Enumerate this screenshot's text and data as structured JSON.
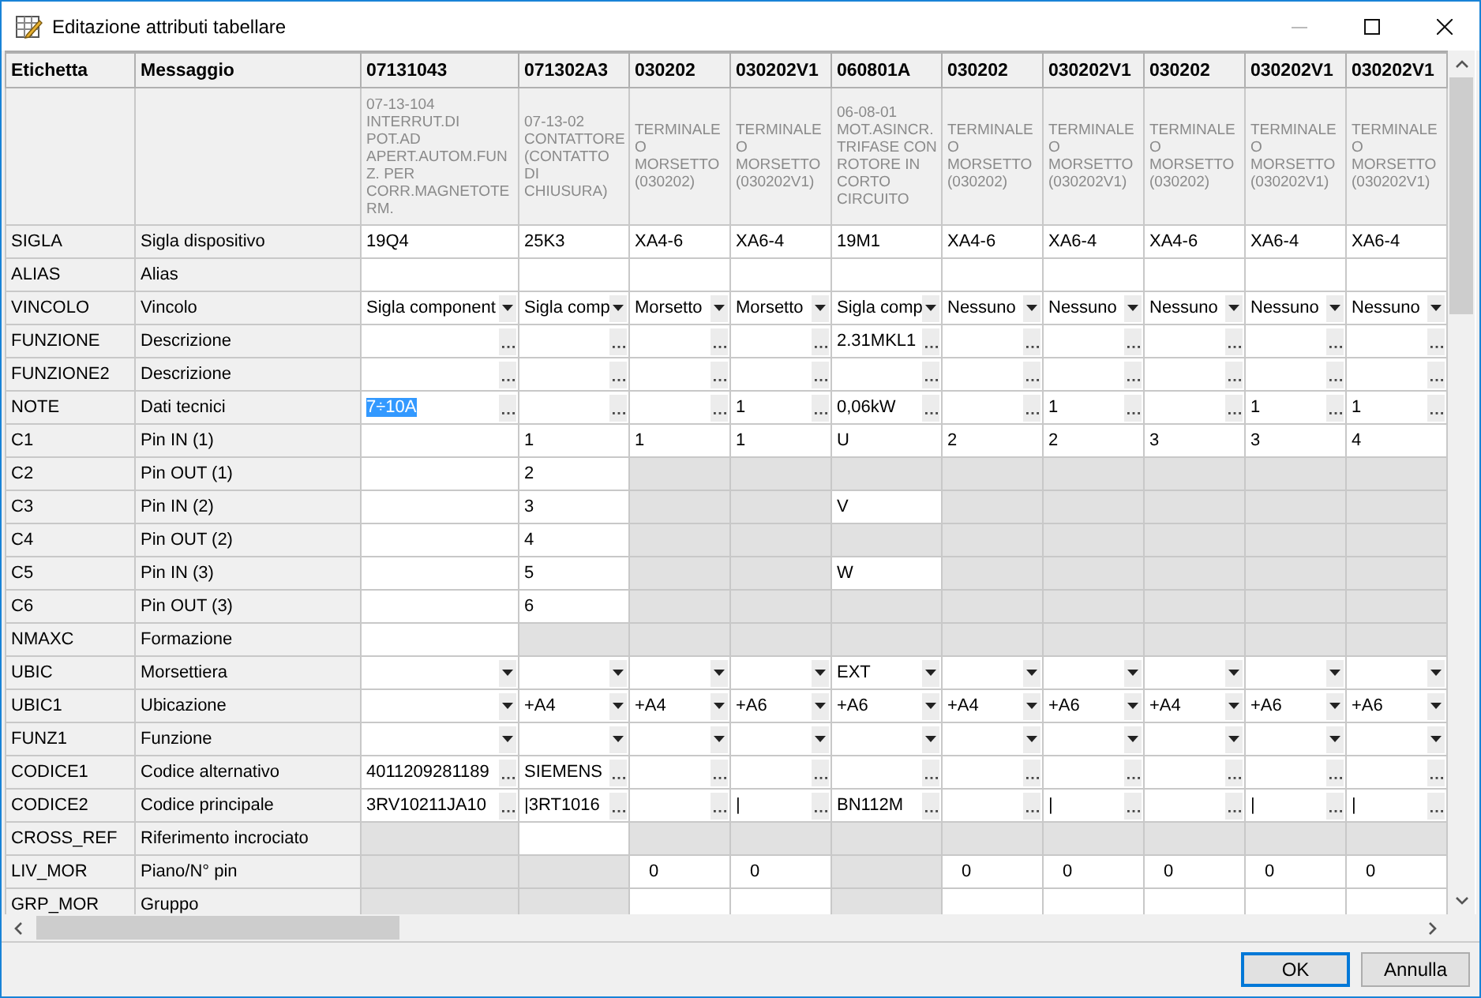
{
  "window": {
    "title": "Editazione attributi tabellare"
  },
  "table": {
    "columns": [
      {
        "label": "Etichetta"
      },
      {
        "label": "Messaggio"
      },
      {
        "label": "07131043"
      },
      {
        "label": "071302A3"
      },
      {
        "label": "030202"
      },
      {
        "label": "030202V1"
      },
      {
        "label": "060801A"
      },
      {
        "label": "030202"
      },
      {
        "label": "030202V1"
      },
      {
        "label": "030202"
      },
      {
        "label": "030202V1"
      },
      {
        "label": "030202V1"
      }
    ],
    "rows": [
      {
        "cells": [
          {
            "kind": "label"
          },
          {
            "kind": "label"
          },
          {
            "kind": "description",
            "value": "07-13-104 INTERRUT.DI POT.AD APERT.AUTOM.FUNZ. PER CORR.MAGNETOTERM."
          },
          {
            "kind": "description",
            "value": "07-13-02 CONTATTORE (CONTATTO DI CHIUSURA)"
          },
          {
            "kind": "description",
            "value": "TERMINALE O MORSETTO (030202)"
          },
          {
            "kind": "description",
            "value": "TERMINALE O MORSETTO (030202V1)"
          },
          {
            "kind": "description",
            "value": "06-08-01 MOT.ASINCR. TRIFASE CON ROTORE IN CORTO CIRCUITO"
          },
          {
            "kind": "description",
            "value": "TERMINALE O MORSETTO (030202)"
          },
          {
            "kind": "description",
            "value": "TERMINALE O MORSETTO (030202V1)"
          },
          {
            "kind": "description",
            "value": "TERMINALE O MORSETTO (030202)"
          },
          {
            "kind": "description",
            "value": "TERMINALE O MORSETTO (030202V1)"
          },
          {
            "kind": "description",
            "value": "TERMINALE O MORSETTO (030202V1)"
          }
        ]
      },
      {
        "cells": [
          {
            "kind": "label",
            "value": "SIGLA"
          },
          {
            "kind": "label",
            "value": "Sigla dispositivo"
          },
          {
            "kind": "text",
            "value": "19Q4"
          },
          {
            "kind": "text",
            "value": "25K3"
          },
          {
            "kind": "text",
            "value": "XA4-6"
          },
          {
            "kind": "text",
            "value": "XA6-4"
          },
          {
            "kind": "text",
            "value": "19M1"
          },
          {
            "kind": "text",
            "value": "XA4-6"
          },
          {
            "kind": "text",
            "value": "XA6-4"
          },
          {
            "kind": "text",
            "value": "XA4-6"
          },
          {
            "kind": "text",
            "value": "XA6-4"
          },
          {
            "kind": "text",
            "value": "XA6-4"
          }
        ]
      },
      {
        "cells": [
          {
            "kind": "label",
            "value": "ALIAS"
          },
          {
            "kind": "label",
            "value": "Alias"
          },
          {
            "kind": "text"
          },
          {
            "kind": "text"
          },
          {
            "kind": "text"
          },
          {
            "kind": "text"
          },
          {
            "kind": "text"
          },
          {
            "kind": "text"
          },
          {
            "kind": "text"
          },
          {
            "kind": "text"
          },
          {
            "kind": "text"
          },
          {
            "kind": "text"
          }
        ]
      },
      {
        "cells": [
          {
            "kind": "label",
            "value": "VINCOLO"
          },
          {
            "kind": "label",
            "value": "Vincolo"
          },
          {
            "kind": "combo",
            "value": "Sigla component"
          },
          {
            "kind": "combo",
            "value": "Sigla comp"
          },
          {
            "kind": "combo",
            "value": "Morsetto"
          },
          {
            "kind": "combo",
            "value": "Morsetto"
          },
          {
            "kind": "combo",
            "value": "Sigla comp"
          },
          {
            "kind": "combo",
            "value": "Nessuno"
          },
          {
            "kind": "combo",
            "value": "Nessuno"
          },
          {
            "kind": "combo",
            "value": "Nessuno"
          },
          {
            "kind": "combo",
            "value": "Nessuno"
          },
          {
            "kind": "combo",
            "value": "Nessuno"
          }
        ]
      },
      {
        "cells": [
          {
            "kind": "label",
            "value": "FUNZIONE"
          },
          {
            "kind": "label",
            "value": "Descrizione"
          },
          {
            "kind": "browse"
          },
          {
            "kind": "browse"
          },
          {
            "kind": "browse"
          },
          {
            "kind": "browse"
          },
          {
            "kind": "browse",
            "value": "2.31MKL1"
          },
          {
            "kind": "browse"
          },
          {
            "kind": "browse"
          },
          {
            "kind": "browse"
          },
          {
            "kind": "browse"
          },
          {
            "kind": "browse"
          }
        ]
      },
      {
        "cells": [
          {
            "kind": "label",
            "value": "FUNZIONE2"
          },
          {
            "kind": "label",
            "value": "Descrizione"
          },
          {
            "kind": "browse"
          },
          {
            "kind": "browse"
          },
          {
            "kind": "browse"
          },
          {
            "kind": "browse"
          },
          {
            "kind": "browse"
          },
          {
            "kind": "browse"
          },
          {
            "kind": "browse"
          },
          {
            "kind": "browse"
          },
          {
            "kind": "browse"
          },
          {
            "kind": "browse"
          }
        ]
      },
      {
        "cells": [
          {
            "kind": "label",
            "value": "NOTE"
          },
          {
            "kind": "label",
            "value": "Dati tecnici"
          },
          {
            "kind": "editing",
            "value": "7÷10A"
          },
          {
            "kind": "browse"
          },
          {
            "kind": "browse"
          },
          {
            "kind": "browse",
            "value": "1"
          },
          {
            "kind": "browse",
            "value": "0,06kW"
          },
          {
            "kind": "browse"
          },
          {
            "kind": "browse",
            "value": "1"
          },
          {
            "kind": "browse"
          },
          {
            "kind": "browse",
            "value": "1"
          },
          {
            "kind": "browse",
            "value": "1"
          }
        ]
      },
      {
        "cells": [
          {
            "kind": "label",
            "value": "C1"
          },
          {
            "kind": "label",
            "value": "Pin IN (1)"
          },
          {
            "kind": "text"
          },
          {
            "kind": "text",
            "value": "1"
          },
          {
            "kind": "text",
            "value": "1"
          },
          {
            "kind": "text",
            "value": "1"
          },
          {
            "kind": "text",
            "value": "U"
          },
          {
            "kind": "text",
            "value": "2"
          },
          {
            "kind": "text",
            "value": "2"
          },
          {
            "kind": "text",
            "value": "3"
          },
          {
            "kind": "text",
            "value": "3"
          },
          {
            "kind": "text",
            "value": "4"
          }
        ]
      },
      {
        "cells": [
          {
            "kind": "label",
            "value": "C2"
          },
          {
            "kind": "label",
            "value": "Pin OUT (1)"
          },
          {
            "kind": "text"
          },
          {
            "kind": "text",
            "value": "2"
          },
          {
            "kind": "off"
          },
          {
            "kind": "off"
          },
          {
            "kind": "off"
          },
          {
            "kind": "off"
          },
          {
            "kind": "off"
          },
          {
            "kind": "off"
          },
          {
            "kind": "off"
          },
          {
            "kind": "off"
          }
        ]
      },
      {
        "cells": [
          {
            "kind": "label",
            "value": "C3"
          },
          {
            "kind": "label",
            "value": "Pin IN (2)"
          },
          {
            "kind": "text"
          },
          {
            "kind": "text",
            "value": "3"
          },
          {
            "kind": "off"
          },
          {
            "kind": "off"
          },
          {
            "kind": "text",
            "value": "V"
          },
          {
            "kind": "off"
          },
          {
            "kind": "off"
          },
          {
            "kind": "off"
          },
          {
            "kind": "off"
          },
          {
            "kind": "off"
          }
        ]
      },
      {
        "cells": [
          {
            "kind": "label",
            "value": "C4"
          },
          {
            "kind": "label",
            "value": "Pin OUT (2)"
          },
          {
            "kind": "text"
          },
          {
            "kind": "text",
            "value": "4"
          },
          {
            "kind": "off"
          },
          {
            "kind": "off"
          },
          {
            "kind": "off"
          },
          {
            "kind": "off"
          },
          {
            "kind": "off"
          },
          {
            "kind": "off"
          },
          {
            "kind": "off"
          },
          {
            "kind": "off"
          }
        ]
      },
      {
        "cells": [
          {
            "kind": "label",
            "value": "C5"
          },
          {
            "kind": "label",
            "value": "Pin IN (3)"
          },
          {
            "kind": "text"
          },
          {
            "kind": "text",
            "value": "5"
          },
          {
            "kind": "off"
          },
          {
            "kind": "off"
          },
          {
            "kind": "text",
            "value": "W"
          },
          {
            "kind": "off"
          },
          {
            "kind": "off"
          },
          {
            "kind": "off"
          },
          {
            "kind": "off"
          },
          {
            "kind": "off"
          }
        ]
      },
      {
        "cells": [
          {
            "kind": "label",
            "value": "C6"
          },
          {
            "kind": "label",
            "value": "Pin OUT (3)"
          },
          {
            "kind": "text"
          },
          {
            "kind": "text",
            "value": "6"
          },
          {
            "kind": "off"
          },
          {
            "kind": "off"
          },
          {
            "kind": "off"
          },
          {
            "kind": "off"
          },
          {
            "kind": "off"
          },
          {
            "kind": "off"
          },
          {
            "kind": "off"
          },
          {
            "kind": "off"
          }
        ]
      },
      {
        "cells": [
          {
            "kind": "label",
            "value": "NMAXC"
          },
          {
            "kind": "label",
            "value": "Formazione"
          },
          {
            "kind": "text"
          },
          {
            "kind": "off"
          },
          {
            "kind": "off"
          },
          {
            "kind": "off"
          },
          {
            "kind": "off"
          },
          {
            "kind": "off"
          },
          {
            "kind": "off"
          },
          {
            "kind": "off"
          },
          {
            "kind": "off"
          },
          {
            "kind": "off"
          }
        ]
      },
      {
        "cells": [
          {
            "kind": "label",
            "value": "UBIC"
          },
          {
            "kind": "label",
            "value": "Morsettiera"
          },
          {
            "kind": "combo"
          },
          {
            "kind": "combo"
          },
          {
            "kind": "combo"
          },
          {
            "kind": "combo"
          },
          {
            "kind": "combo",
            "value": "EXT"
          },
          {
            "kind": "combo"
          },
          {
            "kind": "combo"
          },
          {
            "kind": "combo"
          },
          {
            "kind": "combo"
          },
          {
            "kind": "combo"
          }
        ]
      },
      {
        "cells": [
          {
            "kind": "label",
            "value": "UBIC1"
          },
          {
            "kind": "label",
            "value": "Ubicazione"
          },
          {
            "kind": "combo"
          },
          {
            "kind": "combo",
            "value": "+A4"
          },
          {
            "kind": "combo",
            "value": "+A4"
          },
          {
            "kind": "combo",
            "value": "+A6"
          },
          {
            "kind": "combo",
            "value": "+A6"
          },
          {
            "kind": "combo",
            "value": "+A4"
          },
          {
            "kind": "combo",
            "value": "+A6"
          },
          {
            "kind": "combo",
            "value": "+A4"
          },
          {
            "kind": "combo",
            "value": "+A6"
          },
          {
            "kind": "combo",
            "value": "+A6"
          }
        ]
      },
      {
        "cells": [
          {
            "kind": "label",
            "value": "FUNZ1"
          },
          {
            "kind": "label",
            "value": "Funzione"
          },
          {
            "kind": "combo"
          },
          {
            "kind": "combo"
          },
          {
            "kind": "combo"
          },
          {
            "kind": "combo"
          },
          {
            "kind": "combo"
          },
          {
            "kind": "combo"
          },
          {
            "kind": "combo"
          },
          {
            "kind": "combo"
          },
          {
            "kind": "combo"
          },
          {
            "kind": "combo"
          }
        ]
      },
      {
        "cells": [
          {
            "kind": "label",
            "value": "CODICE1"
          },
          {
            "kind": "label",
            "value": "Codice alternativo"
          },
          {
            "kind": "browse",
            "value": "4011209281189"
          },
          {
            "kind": "browse",
            "value": "SIEMENS"
          },
          {
            "kind": "browse"
          },
          {
            "kind": "browse"
          },
          {
            "kind": "browse"
          },
          {
            "kind": "browse"
          },
          {
            "kind": "browse"
          },
          {
            "kind": "browse"
          },
          {
            "kind": "browse"
          },
          {
            "kind": "browse"
          }
        ]
      },
      {
        "cells": [
          {
            "kind": "label",
            "value": "CODICE2"
          },
          {
            "kind": "label",
            "value": "Codice principale"
          },
          {
            "kind": "browse",
            "value": "3RV10211JA10"
          },
          {
            "kind": "browse",
            "value": "|3RT1016"
          },
          {
            "kind": "browse"
          },
          {
            "kind": "browse",
            "value": "|"
          },
          {
            "kind": "browse",
            "value": "BN112M"
          },
          {
            "kind": "browse"
          },
          {
            "kind": "browse",
            "value": "|"
          },
          {
            "kind": "browse"
          },
          {
            "kind": "browse",
            "value": "|"
          },
          {
            "kind": "browse",
            "value": "|"
          }
        ]
      },
      {
        "cells": [
          {
            "kind": "label",
            "value": "CROSS_REF"
          },
          {
            "kind": "label",
            "value": "Riferimento incrociato"
          },
          {
            "kind": "off"
          },
          {
            "kind": "text"
          },
          {
            "kind": "off"
          },
          {
            "kind": "off"
          },
          {
            "kind": "off"
          },
          {
            "kind": "off"
          },
          {
            "kind": "off"
          },
          {
            "kind": "off"
          },
          {
            "kind": "off"
          },
          {
            "kind": "off"
          }
        ]
      },
      {
        "cells": [
          {
            "kind": "label",
            "value": "LIV_MOR"
          },
          {
            "kind": "label",
            "value": "Piano/N° pin"
          },
          {
            "kind": "off"
          },
          {
            "kind": "off"
          },
          {
            "kind": "number",
            "value": "0"
          },
          {
            "kind": "number",
            "value": "0"
          },
          {
            "kind": "off"
          },
          {
            "kind": "number",
            "value": "0"
          },
          {
            "kind": "number",
            "value": "0"
          },
          {
            "kind": "number",
            "value": "0"
          },
          {
            "kind": "number",
            "value": "0"
          },
          {
            "kind": "number",
            "value": "0"
          }
        ]
      },
      {
        "cells": [
          {
            "kind": "label",
            "value": "GRP_MOR"
          },
          {
            "kind": "label",
            "value": "Gruppo"
          },
          {
            "kind": "off"
          },
          {
            "kind": "off"
          },
          {
            "kind": "text"
          },
          {
            "kind": "text"
          },
          {
            "kind": "off"
          },
          {
            "kind": "text"
          },
          {
            "kind": "text"
          },
          {
            "kind": "text"
          },
          {
            "kind": "text"
          },
          {
            "kind": "text"
          }
        ]
      }
    ]
  },
  "buttons": [
    {
      "label": "OK",
      "default": true
    },
    {
      "label": "Annulla",
      "default": false
    }
  ]
}
